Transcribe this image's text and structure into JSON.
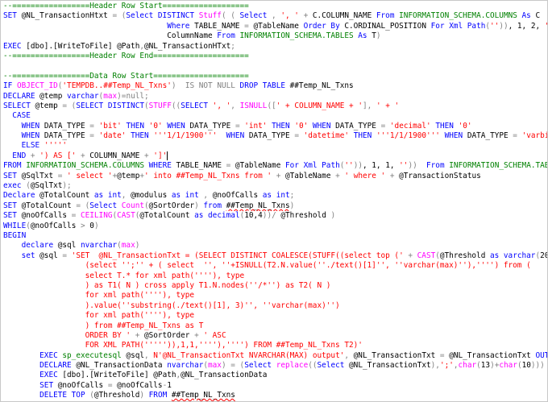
{
  "colors": {
    "keyword": "#0000ff",
    "string": "#ff0000",
    "comment": "#008000",
    "function": "#ff00ff",
    "system": "#008000",
    "operator": "#808080",
    "plain": "#000000",
    "background": "#ffffff"
  },
  "editor": {
    "lines": [
      [
        [
          "cm",
          "--=================Header Row Start==================="
        ]
      ],
      [
        [
          "kw",
          "SET "
        ],
        [
          "pl",
          "@NL_TransactionHtxt "
        ],
        [
          "gray",
          "= ("
        ],
        [
          "kw",
          "Select DISTINCT "
        ],
        [
          "fn",
          "Stuff"
        ],
        [
          "gray",
          "( ( "
        ],
        [
          "kw",
          "Select "
        ],
        [
          "gray",
          ", "
        ],
        [
          "str",
          "', '"
        ],
        [
          "gray",
          " + "
        ],
        [
          "pl",
          "C.COLUMN_NAME "
        ],
        [
          "kw",
          "From "
        ],
        [
          "sys",
          "INFORMATION_SCHEMA.COLUMNS "
        ],
        [
          "kw",
          "As "
        ],
        [
          "pl",
          "C"
        ]
      ],
      [
        [
          "pl",
          "                                    "
        ],
        [
          "kw",
          "Where "
        ],
        [
          "pl",
          "TABLE_NAME "
        ],
        [
          "gray",
          "= "
        ],
        [
          "pl",
          "@TableName "
        ],
        [
          "kw",
          "Order By "
        ],
        [
          "pl",
          "C.ORDINAL_POSITION "
        ],
        [
          "kw",
          "For Xml Path"
        ],
        [
          "gray",
          "("
        ],
        [
          "str",
          "''"
        ],
        [
          "gray",
          "))"
        ],
        [
          "pl",
          ", 1, 2, "
        ],
        [
          "str",
          "''"
        ],
        [
          "gray",
          ") "
        ],
        [
          "kw",
          "As"
        ]
      ],
      [
        [
          "pl",
          "                                    ColumnName "
        ],
        [
          "kw",
          "From "
        ],
        [
          "sys",
          "INFORMATION_SCHEMA.TABLES "
        ],
        [
          "kw",
          "As "
        ],
        [
          "pl",
          "T"
        ],
        [
          "gray",
          ")"
        ]
      ],
      [
        [
          "kw",
          "EXEC "
        ],
        [
          "pl",
          "[dbo].[WriteToFile] @Path"
        ],
        [
          "gray",
          ","
        ],
        [
          "pl",
          "@NL_TransactionHTxt"
        ],
        [
          "gray",
          ";"
        ]
      ],
      [
        [
          "cm",
          "--=================Header Row End====================="
        ]
      ],
      [
        [
          "pl",
          ""
        ]
      ],
      [
        [
          "cm",
          "--=================Data Row Start====================="
        ]
      ],
      [
        [
          "kw",
          "IF "
        ],
        [
          "fn",
          "OBJECT_ID"
        ],
        [
          "gray",
          "("
        ],
        [
          "str",
          "'TEMPDB..##Temp_NL_Txns'"
        ],
        [
          "gray",
          ")  "
        ],
        [
          "gray",
          "IS NOT NULL "
        ],
        [
          "kw",
          "DROP TABLE "
        ],
        [
          "pl",
          "##Temp_NL_Txns"
        ]
      ],
      [
        [
          "kw",
          "DECLARE "
        ],
        [
          "pl",
          "@temp "
        ],
        [
          "kw",
          "varchar"
        ],
        [
          "gray",
          "("
        ],
        [
          "fn",
          "max"
        ],
        [
          "gray",
          ")="
        ],
        [
          "gray",
          "null"
        ],
        [
          "gray",
          ";"
        ]
      ],
      [
        [
          "kw",
          "SELECT "
        ],
        [
          "pl",
          "@temp "
        ],
        [
          "gray",
          "= ("
        ],
        [
          "kw",
          "SELECT DISTINCT"
        ],
        [
          "gray",
          "("
        ],
        [
          "fn",
          "STUFF"
        ],
        [
          "gray",
          "(("
        ],
        [
          "kw",
          "SELECT "
        ],
        [
          "str",
          "', '"
        ],
        [
          "gray",
          ", "
        ],
        [
          "fn",
          "ISNULL"
        ],
        [
          "gray",
          "(["
        ],
        [
          "str",
          "' + COLUMN_NAME + '"
        ],
        [
          "gray",
          "], "
        ],
        [
          "str",
          "' + '"
        ]
      ],
      [
        [
          "pl",
          "  "
        ],
        [
          "kw",
          "CASE"
        ]
      ],
      [
        [
          "pl",
          "    "
        ],
        [
          "kw",
          "WHEN "
        ],
        [
          "pl",
          "DATA_TYPE "
        ],
        [
          "gray",
          "= "
        ],
        [
          "str",
          "'bit'"
        ],
        [
          "kw",
          " THEN "
        ],
        [
          "str",
          "'0'"
        ],
        [
          "kw",
          " WHEN "
        ],
        [
          "pl",
          "DATA_TYPE "
        ],
        [
          "gray",
          "= "
        ],
        [
          "str",
          "'int'"
        ],
        [
          "kw",
          " THEN "
        ],
        [
          "str",
          "'0'"
        ],
        [
          "kw",
          " WHEN "
        ],
        [
          "pl",
          "DATA_TYPE "
        ],
        [
          "gray",
          "= "
        ],
        [
          "str",
          "'decimal'"
        ],
        [
          "kw",
          " THEN "
        ],
        [
          "str",
          "'0'"
        ]
      ],
      [
        [
          "pl",
          "    "
        ],
        [
          "kw",
          "WHEN "
        ],
        [
          "pl",
          "DATA_TYPE "
        ],
        [
          "gray",
          "= "
        ],
        [
          "str",
          "'date'"
        ],
        [
          "kw",
          " THEN "
        ],
        [
          "str",
          "'''1/1/1900'''"
        ],
        [
          "kw",
          "  WHEN "
        ],
        [
          "pl",
          "DATA_TYPE "
        ],
        [
          "gray",
          "= "
        ],
        [
          "str",
          "'datetime'"
        ],
        [
          "kw",
          " THEN "
        ],
        [
          "str",
          "'''1/1/1900'''"
        ],
        [
          "kw",
          " WHEN "
        ],
        [
          "pl",
          "DATA_TYPE "
        ],
        [
          "gray",
          "= "
        ],
        [
          "str",
          "'varbinary'"
        ],
        [
          "kw",
          " THEN "
        ],
        [
          "str",
          "'0x'"
        ]
      ],
      [
        [
          "pl",
          "    "
        ],
        [
          "kw",
          "ELSE "
        ],
        [
          "str",
          "'''''"
        ]
      ],
      [
        [
          "pl",
          "  "
        ],
        [
          "kw",
          "END "
        ],
        [
          "gray",
          "+ "
        ],
        [
          "str",
          "') AS ['"
        ],
        [
          "gray",
          " + "
        ],
        [
          "pl",
          "COLUMN_NAME "
        ],
        [
          "gray",
          "+ "
        ],
        [
          "str",
          "']'"
        ],
        [
          "caret",
          ""
        ]
      ],
      [
        [
          "kw",
          "FROM "
        ],
        [
          "sys",
          "INFORMATION_SCHEMA.COLUMNS "
        ],
        [
          "kw",
          "WHERE "
        ],
        [
          "pl",
          "TABLE_NAME "
        ],
        [
          "gray",
          "= "
        ],
        [
          "pl",
          "@TableName "
        ],
        [
          "kw",
          "For Xml Path"
        ],
        [
          "gray",
          "("
        ],
        [
          "str",
          "''"
        ],
        [
          "gray",
          "))"
        ],
        [
          "pl",
          ", 1, 1, "
        ],
        [
          "str",
          "''"
        ],
        [
          "gray",
          "))  "
        ],
        [
          "kw",
          "From "
        ],
        [
          "sys",
          "INFORMATION_SCHEMA.TABLES "
        ],
        [
          "kw",
          "As "
        ],
        [
          "pl",
          "T"
        ],
        [
          "gray",
          ");"
        ]
      ],
      [
        [
          "kw",
          "SET "
        ],
        [
          "pl",
          "@SqlTxt "
        ],
        [
          "gray",
          "= "
        ],
        [
          "str",
          "' select '"
        ],
        [
          "gray",
          "+"
        ],
        [
          "pl",
          "@temp"
        ],
        [
          "gray",
          "+"
        ],
        [
          "str",
          "' into ##Temp_NL_Txns from '"
        ],
        [
          "gray",
          " + "
        ],
        [
          "pl",
          "@TableName "
        ],
        [
          "gray",
          "+ "
        ],
        [
          "str",
          "' where '"
        ],
        [
          "gray",
          " + "
        ],
        [
          "pl",
          "@TransactionStatus"
        ]
      ],
      [
        [
          "kw",
          "exec "
        ],
        [
          "gray",
          "("
        ],
        [
          "pl",
          "@SqlTxt"
        ],
        [
          "gray",
          ");"
        ]
      ],
      [
        [
          "kw",
          "Declare "
        ],
        [
          "pl",
          "@TotalCount "
        ],
        [
          "kw",
          "as int"
        ],
        [
          "gray",
          ", "
        ],
        [
          "pl",
          "@modulus "
        ],
        [
          "kw",
          "as int "
        ],
        [
          "gray",
          ", "
        ],
        [
          "pl",
          "@noOfCalls "
        ],
        [
          "kw",
          "as int"
        ],
        [
          "gray",
          ";"
        ]
      ],
      [
        [
          "kw",
          "SET "
        ],
        [
          "pl",
          "@TotalCount "
        ],
        [
          "gray",
          "= ("
        ],
        [
          "kw",
          "Select "
        ],
        [
          "fn",
          "Count"
        ],
        [
          "gray",
          "("
        ],
        [
          "pl",
          "@SortOrder"
        ],
        [
          "gray",
          ") "
        ],
        [
          "kw",
          "from "
        ],
        [
          "sq",
          "##Temp_NL_Txns"
        ],
        [
          "gray",
          ")"
        ]
      ],
      [
        [
          "kw",
          "SET "
        ],
        [
          "pl",
          "@noOfCalls "
        ],
        [
          "gray",
          "= "
        ],
        [
          "fn",
          "CEILING"
        ],
        [
          "gray",
          "("
        ],
        [
          "fn",
          "CAST"
        ],
        [
          "gray",
          "("
        ],
        [
          "pl",
          "@TotalCount "
        ],
        [
          "kw",
          "as decimal"
        ],
        [
          "gray",
          "("
        ],
        [
          "pl",
          "10,4"
        ],
        [
          "gray",
          "))"
        ],
        [
          "gray",
          "/ "
        ],
        [
          "pl",
          "@Threshold "
        ],
        [
          "gray",
          ")"
        ]
      ],
      [
        [
          "kw",
          "WHILE"
        ],
        [
          "gray",
          "("
        ],
        [
          "pl",
          "@noOfCalls "
        ],
        [
          "gray",
          "> "
        ],
        [
          "pl",
          "0"
        ],
        [
          "gray",
          ")"
        ]
      ],
      [
        [
          "kw",
          "BEGIN"
        ]
      ],
      [
        [
          "pl",
          "    "
        ],
        [
          "kw",
          "declare "
        ],
        [
          "pl",
          "@sql "
        ],
        [
          "kw",
          "nvarchar"
        ],
        [
          "gray",
          "("
        ],
        [
          "fn",
          "max"
        ],
        [
          "gray",
          ")"
        ]
      ],
      [
        [
          "pl",
          "    "
        ],
        [
          "kw",
          "set "
        ],
        [
          "pl",
          "@sql "
        ],
        [
          "gray",
          "= "
        ],
        [
          "str",
          "'SET  @NL_TransactionTxt = (SELECT DISTINCT COALESCE(STUFF((select top ('"
        ],
        [
          "gray",
          " + "
        ],
        [
          "fn",
          "CAST"
        ],
        [
          "gray",
          "("
        ],
        [
          "pl",
          "@Threshold "
        ],
        [
          "kw",
          "as varchar"
        ],
        [
          "gray",
          "("
        ],
        [
          "pl",
          "20"
        ],
        [
          "gray",
          "))+ "
        ],
        [
          "str",
          "')"
        ]
      ],
      [
        [
          "str",
          "                  (select '';'' + ( select  '', ''+ISNULL(T2.N.value(''./text()[1]'', ''varchar(max)''),'''') from ("
        ]
      ],
      [
        [
          "str",
          "                  select T.* for xml path(''''), type"
        ]
      ],
      [
        [
          "str",
          "                  ) as T1( N ) cross apply T1.N.nodes(''/*'') as T2( N )"
        ]
      ],
      [
        [
          "str",
          "                  for xml path(''''), type"
        ]
      ],
      [
        [
          "str",
          "                  ).value(''substring(./text()[1], 3)'', ''varchar(max)'')"
        ]
      ],
      [
        [
          "str",
          "                  for xml path(''''), type"
        ]
      ],
      [
        [
          "str",
          "                  ) from ##Temp_NL_Txns as T"
        ]
      ],
      [
        [
          "str",
          "                  ORDER BY '"
        ],
        [
          "gray",
          " + "
        ],
        [
          "pl",
          "@SortOrder "
        ],
        [
          "gray",
          "+ "
        ],
        [
          "str",
          "' ASC"
        ]
      ],
      [
        [
          "str",
          "                  FOR XML PATH(''''')),1,1,''''),'''') FROM ##Temp_NL_Txns T2)'"
        ]
      ],
      [
        [
          "pl",
          "        "
        ],
        [
          "kw",
          "EXEC "
        ],
        [
          "sys",
          "sp_executesql "
        ],
        [
          "pl",
          "@sql"
        ],
        [
          "gray",
          ", "
        ],
        [
          "str",
          "N'@NL_TransactionTxt NVARCHAR(MAX) output'"
        ],
        [
          "gray",
          ", "
        ],
        [
          "pl",
          "@NL_TransactionTxt "
        ],
        [
          "gray",
          "= "
        ],
        [
          "pl",
          "@NL_TransactionTxt "
        ],
        [
          "kw",
          "OUTPUT"
        ]
      ],
      [
        [
          "pl",
          "        "
        ],
        [
          "kw",
          "DECLARE "
        ],
        [
          "pl",
          "@NL_TransactionData "
        ],
        [
          "kw",
          "nvarchar"
        ],
        [
          "gray",
          "("
        ],
        [
          "fn",
          "max"
        ],
        [
          "gray",
          ") = ("
        ],
        [
          "kw",
          "Select "
        ],
        [
          "fn",
          "replace"
        ],
        [
          "gray",
          "(("
        ],
        [
          "kw",
          "Select "
        ],
        [
          "pl",
          "@NL_TransactionTxt"
        ],
        [
          "gray",
          "),"
        ],
        [
          "str",
          "';'"
        ],
        [
          "gray",
          ","
        ],
        [
          "fn",
          "char"
        ],
        [
          "gray",
          "("
        ],
        [
          "pl",
          "13"
        ],
        [
          "gray",
          ")+"
        ],
        [
          "fn",
          "char"
        ],
        [
          "gray",
          "("
        ],
        [
          "pl",
          "10"
        ],
        [
          "gray",
          ")))"
        ]
      ],
      [
        [
          "pl",
          "        "
        ],
        [
          "kw",
          "EXEC "
        ],
        [
          "pl",
          "[dbo].[WriteToFile] @Path"
        ],
        [
          "gray",
          ","
        ],
        [
          "pl",
          "@NL_TransactionData"
        ]
      ],
      [
        [
          "pl",
          "        "
        ],
        [
          "kw",
          "SET "
        ],
        [
          "pl",
          "@noOfCalls "
        ],
        [
          "gray",
          "= "
        ],
        [
          "pl",
          "@noOfCalls"
        ],
        [
          "gray",
          "-"
        ],
        [
          "pl",
          "1"
        ]
      ],
      [
        [
          "pl",
          "        "
        ],
        [
          "kw",
          "DELETE TOP "
        ],
        [
          "gray",
          "("
        ],
        [
          "pl",
          "@Threshold"
        ],
        [
          "gray",
          ") "
        ],
        [
          "kw",
          "FROM "
        ],
        [
          "sq",
          "##Temp_NL_Txns"
        ]
      ],
      [
        [
          "kw",
          "END"
        ]
      ],
      [
        [
          "pl",
          "    "
        ],
        [
          "kw",
          "DROP TABLE "
        ],
        [
          "sq",
          "##Temp_NL_Txns"
        ]
      ]
    ]
  }
}
